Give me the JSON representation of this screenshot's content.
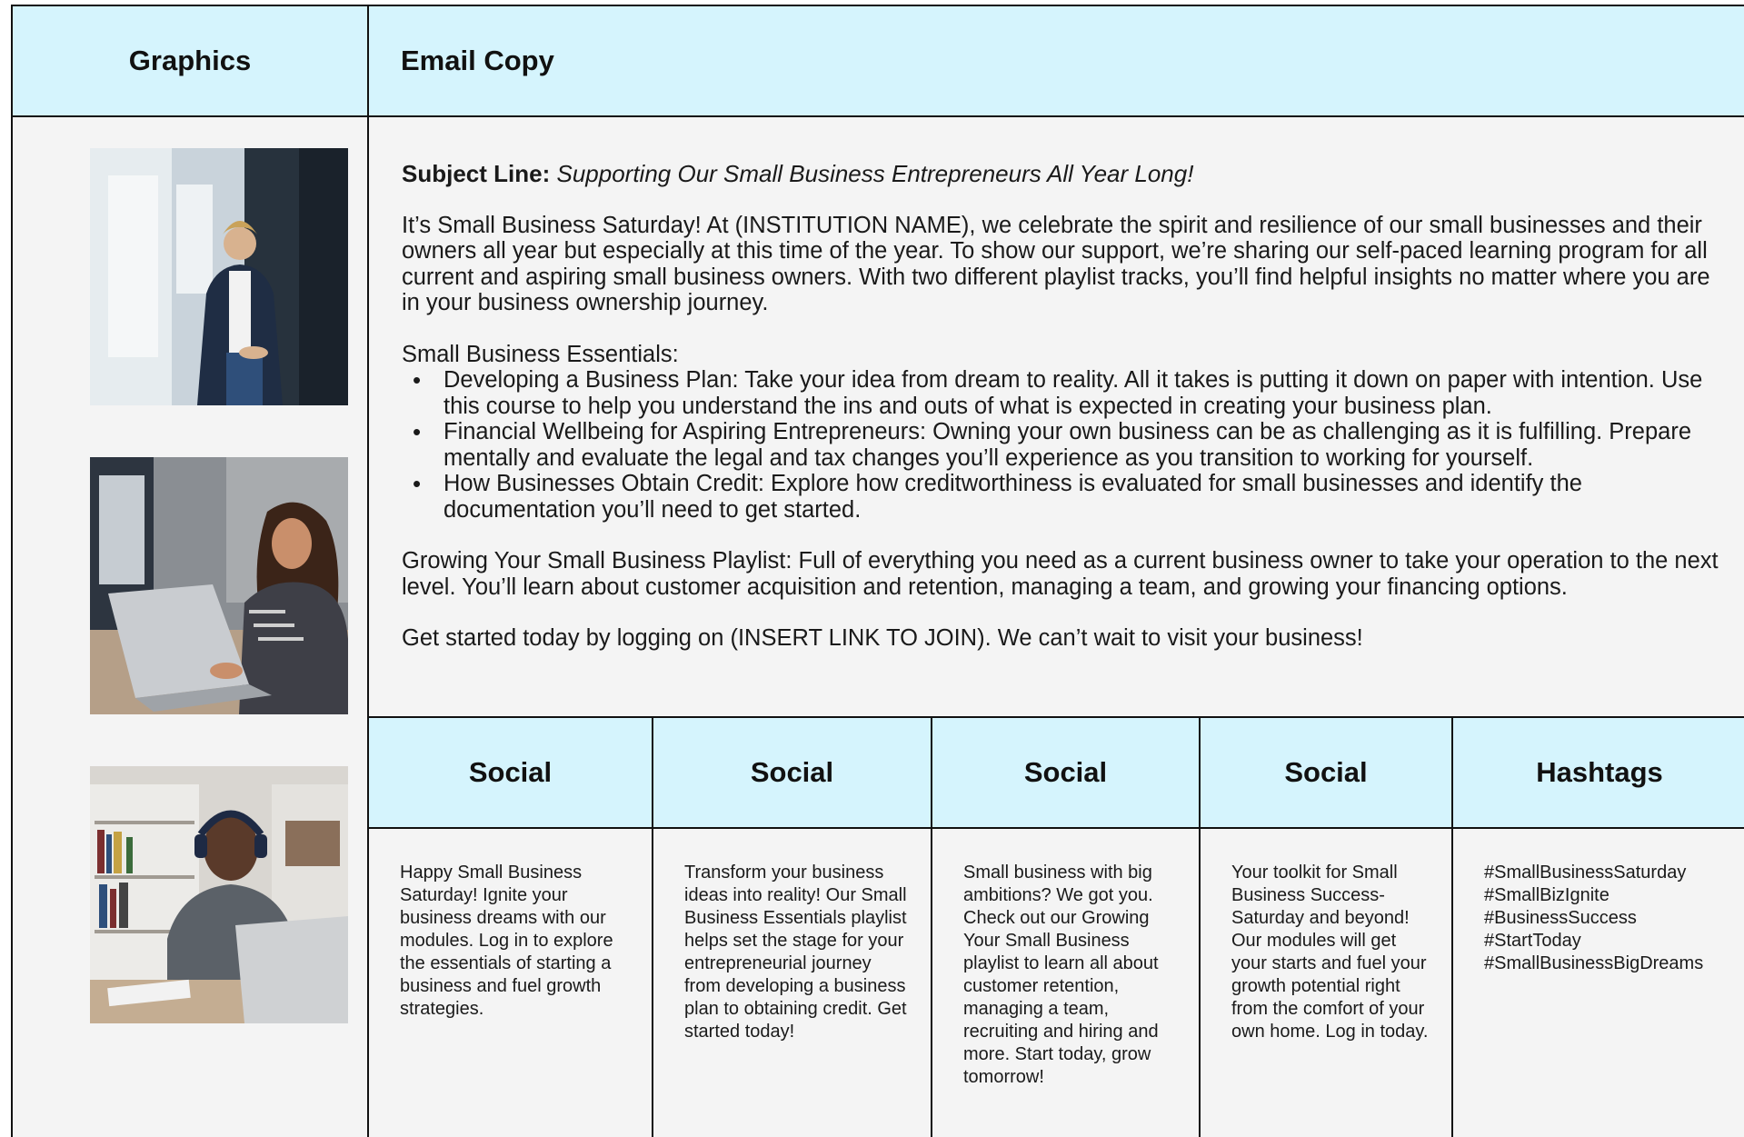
{
  "headers": {
    "graphics": "Graphics",
    "email_copy": "Email Copy"
  },
  "email": {
    "subject_label": "Subject Line:",
    "subject_text": "Supporting Our Small Business Entrepreneurs All Year Long!",
    "intro": "It’s Small Business Saturday!  At (INSTITUTION NAME), we celebrate the spirit and resilience of our small businesses and their owners all year but especially at this time of the year.  To show our support, we’re sharing our self-paced learning program for all current and aspiring small business owners.  With two different playlist tracks, you’ll find helpful insights no matter where you are in your business ownership journey.",
    "essentials_title": "Small Business Essentials:",
    "bullets": [
      "Developing a Business Plan: Take your idea from dream to reality.  All it takes is putting it down on paper with intention.  Use this course to help you understand the ins and outs of what is expected in creating your business plan.",
      "Financial Wellbeing for Aspiring Entrepreneurs: Owning your own business can be as challenging as it is fulfilling.  Prepare mentally and evaluate the legal and tax changes you’ll experience as you transition to working for yourself.",
      "How Businesses Obtain Credit: Explore how creditworthiness is evaluated for small businesses and identify the documentation you’ll need to get started."
    ],
    "growing": "Growing Your Small Business Playlist: Full of everything you need as a current business owner to take your operation to the next level.  You’ll learn about customer acquisition and retention, managing a team, and growing your financing options.",
    "cta": "Get started today by logging on (INSERT LINK TO JOIN).  We can’t wait to visit your business!"
  },
  "social": [
    {
      "header": "Social",
      "text": "Happy Small Business Saturday! Ignite your business dreams with our modules. Log in to explore the essentials of starting a business and fuel growth strategies."
    },
    {
      "header": "Social",
      "text": "Transform your business ideas into reality!  Our Small Business Essentials playlist helps set the stage for your entrepreneurial journey from developing a business plan to obtaining credit.  Get started today!"
    },
    {
      "header": "Social",
      "text": "Small business with big ambitions? We got you. Check out our Growing Your Small Business playlist to learn all about customer retention, managing a team, recruiting and hiring and more.  Start today, grow tomorrow!"
    },
    {
      "header": "Social",
      "text": "Your toolkit for Small Business Success- Saturday and beyond! Our modules will get your starts and fuel your growth potential right from the comfort of your own home.  Log in today."
    }
  ],
  "hashtags": {
    "header": "Hashtags",
    "items": [
      "#SmallBusinessSaturday",
      "#SmallBizIgnite",
      "#BusinessSuccess",
      "#StartToday",
      "#SmallBusinessBigDreams"
    ]
  }
}
